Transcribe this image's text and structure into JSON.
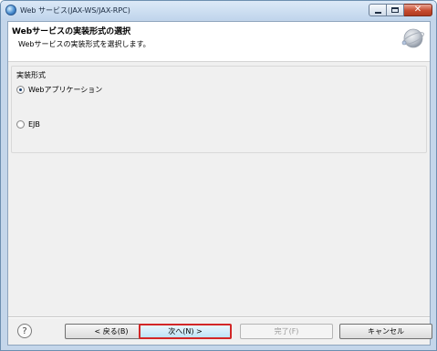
{
  "window": {
    "title": "Web サービス(JAX-WS/JAX-RPC)",
    "close_symbol": "✕"
  },
  "header": {
    "title": "Webサービスの実装形式の選択",
    "description": "Webサービスの実装形式を選択します。"
  },
  "group": {
    "label": "実装形式",
    "options": [
      {
        "label": "Webアプリケーション",
        "selected": true
      },
      {
        "label": "EJB",
        "selected": false
      }
    ]
  },
  "buttons": {
    "help": "?",
    "back": "< 戻る(B)",
    "next": "次へ(N) >",
    "finish": "完了(F)",
    "cancel": "キャンセル"
  }
}
